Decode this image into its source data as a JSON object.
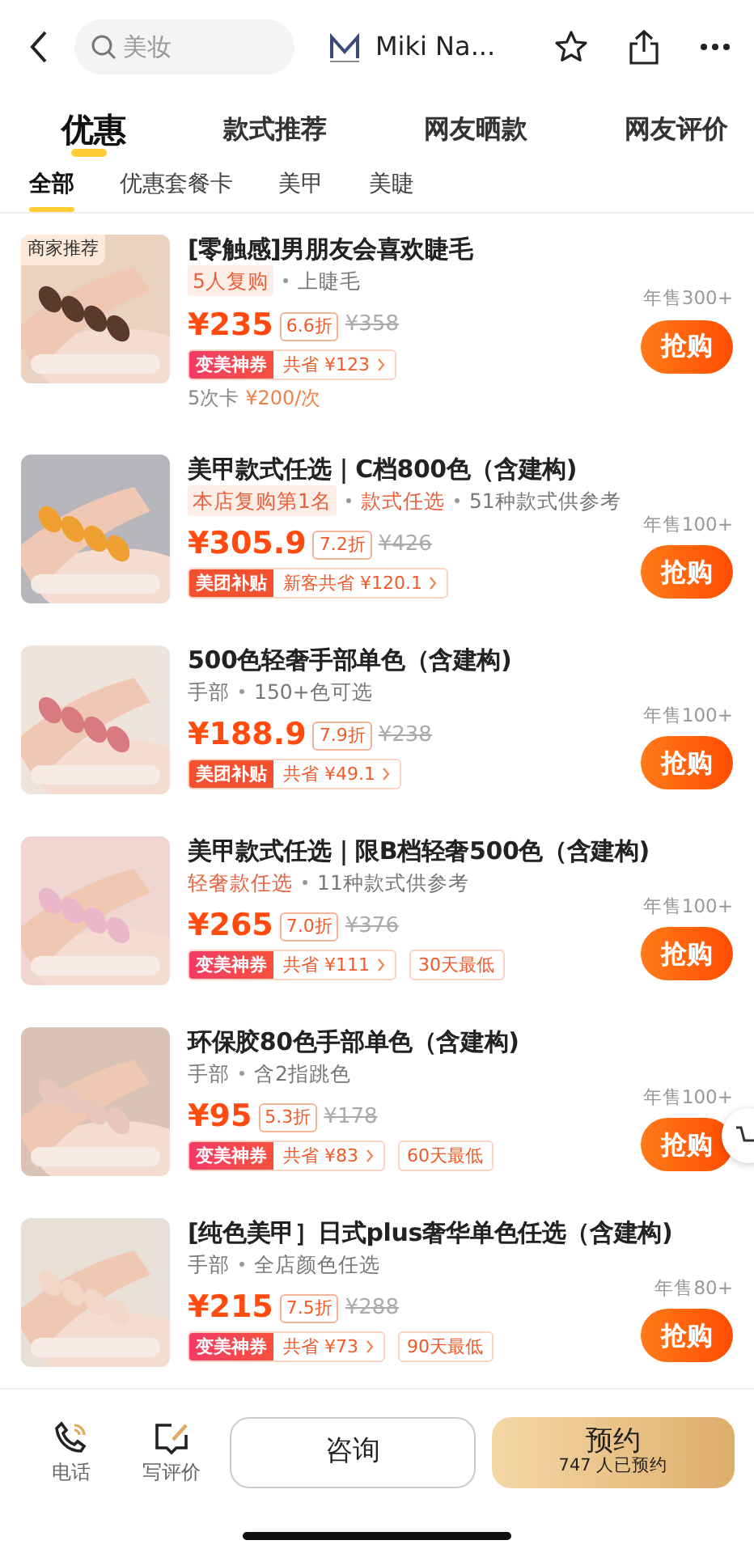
{
  "header": {
    "search_placeholder": "美妆",
    "shop_name": "Miki Na..."
  },
  "tabs": [
    {
      "label": "优惠",
      "selected": true
    },
    {
      "label": "款式推荐",
      "selected": false
    },
    {
      "label": "网友晒款",
      "selected": false
    },
    {
      "label": "网友评价",
      "selected": false
    }
  ],
  "subtabs": [
    {
      "label": "全部",
      "selected": true
    },
    {
      "label": "优惠套餐卡",
      "selected": false
    },
    {
      "label": "美甲",
      "selected": false
    },
    {
      "label": "美睫",
      "selected": false
    }
  ],
  "products": [
    {
      "badge": "商家推荐",
      "title": "[零触感]男朋友会喜欢睫毛",
      "tags": [
        {
          "text": "5人复购",
          "kind": "badge"
        },
        {
          "text": "上睫毛",
          "kind": "plain"
        }
      ],
      "price": "¥235",
      "discount": "6.6折",
      "original_price": "¥358",
      "coupon": {
        "kind": "shenquan",
        "label": "变美神券",
        "savings": "共省 ¥123"
      },
      "card_note": {
        "label": "5次卡",
        "price": "¥200/次"
      },
      "sales": "年售300+",
      "button": "抢购"
    },
    {
      "title": "美甲款式任选｜C档800色（含建构)",
      "tags": [
        {
          "text": "本店复购第1名",
          "kind": "badge"
        },
        {
          "text": "款式任选",
          "kind": "accent"
        },
        {
          "text": "51种款式供参考",
          "kind": "plain"
        }
      ],
      "price": "¥305.9",
      "discount": "7.2折",
      "original_price": "¥426",
      "coupon": {
        "kind": "butie",
        "label": "美团补贴",
        "savings": "新客共省 ¥120.1"
      },
      "sales": "年售100+",
      "button": "抢购"
    },
    {
      "title": "500色轻奢手部单色（含建构)",
      "tags": [
        {
          "text": "手部",
          "kind": "plain"
        },
        {
          "text": "150+色可选",
          "kind": "plain"
        }
      ],
      "price": "¥188.9",
      "discount": "7.9折",
      "original_price": "¥238",
      "coupon": {
        "kind": "butie",
        "label": "美团补贴",
        "savings": "共省 ¥49.1"
      },
      "sales": "年售100+",
      "button": "抢购"
    },
    {
      "title": "美甲款式任选｜限B档轻奢500色（含建构)",
      "tags": [
        {
          "text": "轻奢款任选",
          "kind": "accent"
        },
        {
          "text": "11种款式供参考",
          "kind": "plain"
        }
      ],
      "price": "¥265",
      "discount": "7.0折",
      "original_price": "¥376",
      "coupon": {
        "kind": "shenquan",
        "label": "变美神券",
        "savings": "共省 ¥111"
      },
      "lowest": "30天最低",
      "sales": "年售100+",
      "button": "抢购"
    },
    {
      "title": "环保胶80色手部单色（含建构)",
      "tags": [
        {
          "text": "手部",
          "kind": "plain"
        },
        {
          "text": "含2指跳色",
          "kind": "plain"
        }
      ],
      "price": "¥95",
      "discount": "5.3折",
      "original_price": "¥178",
      "coupon": {
        "kind": "shenquan",
        "label": "变美神券",
        "savings": "共省 ¥83"
      },
      "lowest": "60天最低",
      "sales": "年售100+",
      "button": "抢购"
    },
    {
      "title": "[纯色美甲］日式plus奢华单色任选（含建构)",
      "tags": [
        {
          "text": "手部",
          "kind": "plain"
        },
        {
          "text": "全店颜色任选",
          "kind": "plain"
        }
      ],
      "price": "¥215",
      "discount": "7.5折",
      "original_price": "¥288",
      "coupon": {
        "kind": "shenquan",
        "label": "变美神券",
        "savings": "共省 ¥73"
      },
      "lowest": "90天最低",
      "sales": "年售80+",
      "button": "抢购"
    }
  ],
  "bottom_bar": {
    "phone": "电话",
    "review": "写评价",
    "consult": "咨询",
    "book": "预约",
    "book_count": "747 人已预约"
  }
}
